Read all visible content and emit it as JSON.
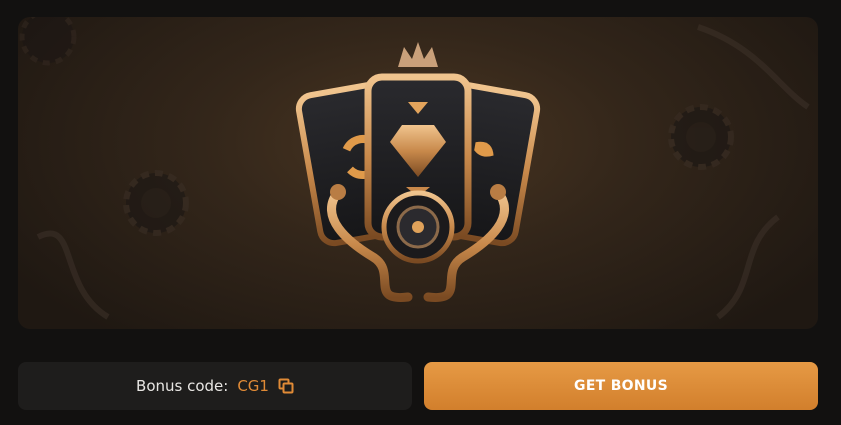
{
  "banner": {
    "art_icon": "casino-cards-crest-icon",
    "background_color": "#3a2a1c"
  },
  "bonus": {
    "code_label": "Bonus code:",
    "code_value": "CG1",
    "copy_icon": "copy-icon",
    "button_label": "GET BONUS"
  },
  "colors": {
    "accent": "#e08a36",
    "button": "#d88a36",
    "panel": "#1e1d1c",
    "page_bg": "#121110"
  }
}
